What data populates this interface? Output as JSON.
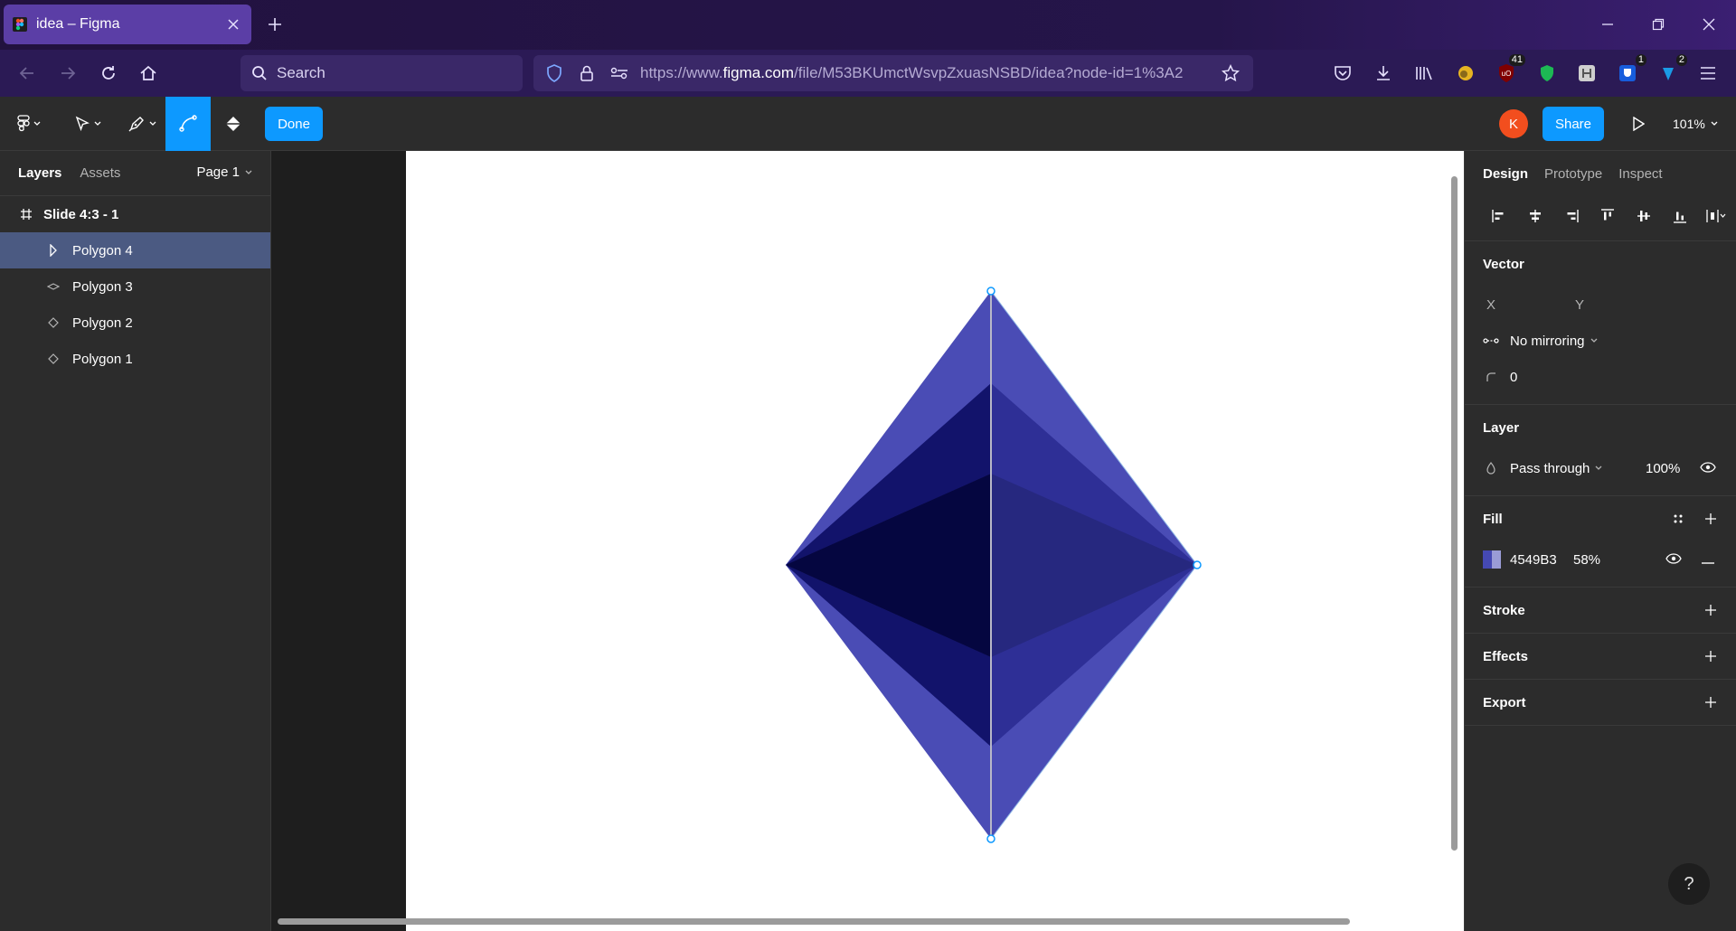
{
  "browser": {
    "tab_title": "idea – Figma",
    "search_placeholder": "Search",
    "url_prefix": "https://www.",
    "url_domain": "figma.com",
    "url_rest": "/file/M53BKUmctWsvpZxuasNSBD/idea?node-id=1%3A2",
    "ext_badge_1": "41",
    "ext_badge_2": "1",
    "ext_badge_3": "2"
  },
  "toolbar": {
    "done_label": "Done",
    "avatar_initial": "K",
    "share_label": "Share",
    "zoom": "101%"
  },
  "left_panel": {
    "tab_layers": "Layers",
    "tab_assets": "Assets",
    "page": "Page 1",
    "frame_name": "Slide 4:3 - 1",
    "layers": [
      "Polygon 4",
      "Polygon 3",
      "Polygon 2",
      "Polygon 1"
    ],
    "selected_layer": "Polygon 4"
  },
  "right_panel": {
    "tabs": [
      "Design",
      "Prototype",
      "Inspect"
    ],
    "active_tab": "Design",
    "vector": {
      "title": "Vector",
      "x_label": "X",
      "y_label": "Y",
      "mirroring": "No mirroring",
      "corner_radius": "0"
    },
    "layer": {
      "title": "Layer",
      "blend": "Pass through",
      "opacity": "100%"
    },
    "fill": {
      "title": "Fill",
      "color_hex": "4549B3",
      "opacity": "58%",
      "swatch_color": "#4549B3"
    },
    "stroke_title": "Stroke",
    "effects_title": "Effects",
    "export_title": "Export",
    "help": "?"
  },
  "colors": {
    "accent": "#0d99ff",
    "avatar": "#f24e1e",
    "shape_light": "#4a4cb5",
    "shape_mid": "#2e2f96",
    "shape_dark": "#12136b",
    "shape_darkest": "#050640"
  }
}
